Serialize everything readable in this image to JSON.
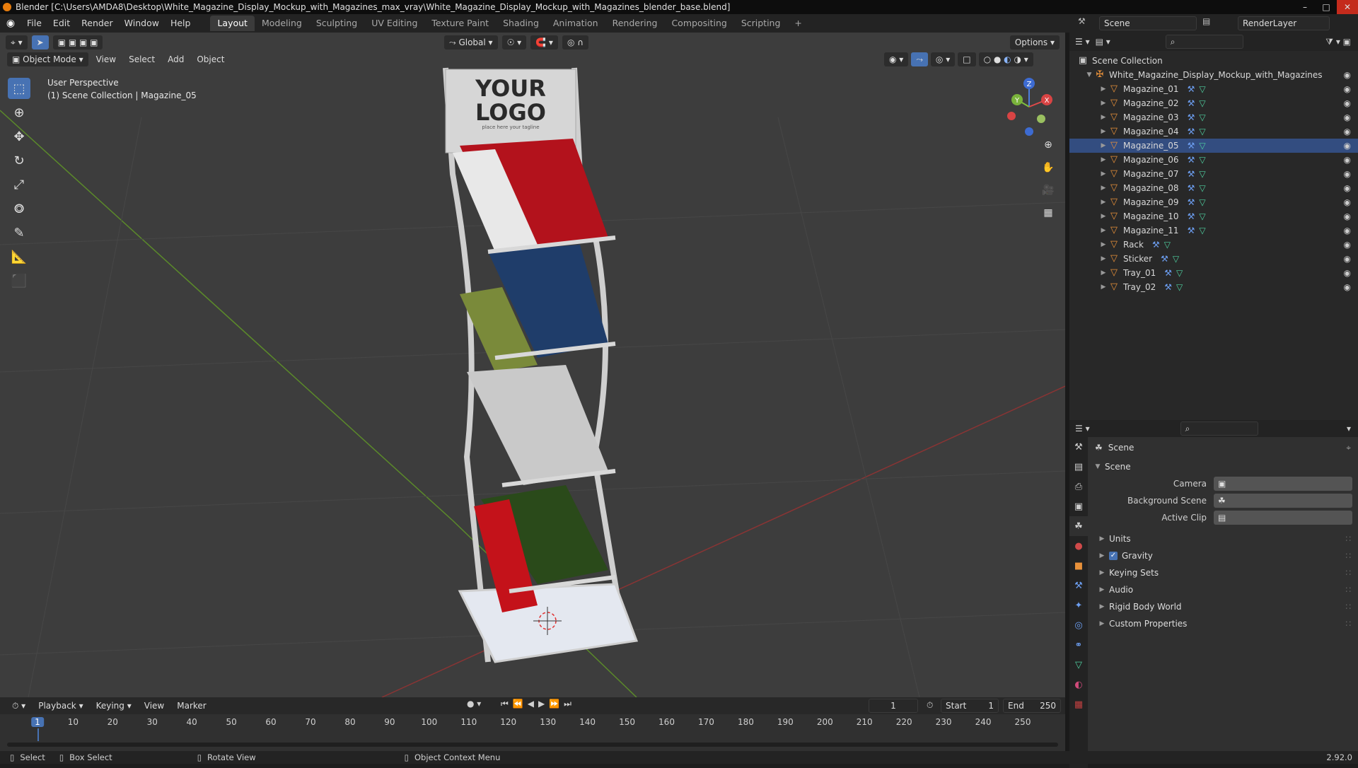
{
  "window": {
    "title": "Blender [C:\\Users\\AMDA8\\Desktop\\White_Magazine_Display_Mockup_with_Magazines_max_vray\\White_Magazine_Display_Mockup_with_Magazines_blender_base.blend]",
    "minimize": "–",
    "maximize": "□",
    "close": "✕"
  },
  "menu": [
    "File",
    "Edit",
    "Render",
    "Window",
    "Help"
  ],
  "workspaces": [
    "Layout",
    "Modeling",
    "Sculpting",
    "UV Editing",
    "Texture Paint",
    "Shading",
    "Animation",
    "Rendering",
    "Compositing",
    "Scripting"
  ],
  "active_workspace": "Layout",
  "add_workspace": "+",
  "scene_name": "Scene",
  "render_layer": "RenderLayer",
  "viewport": {
    "mode": "Object Mode",
    "menus": [
      "View",
      "Select",
      "Add",
      "Object"
    ],
    "transform_orientation": "Global",
    "options": "Options",
    "perspective": "User Perspective",
    "collection_info": "(1) Scene Collection | Magazine_05",
    "sign_logo_line1": "YOUR",
    "sign_logo_line2": "LOGO",
    "sign_tagline": "place here your tagline",
    "gizmo_x": "X",
    "gizmo_y": "Y",
    "gizmo_z": "Z"
  },
  "outliner": {
    "root": "Scene Collection",
    "collection": "White_Magazine_Display_Mockup_with_Magazines",
    "items": [
      "Magazine_01",
      "Magazine_02",
      "Magazine_03",
      "Magazine_04",
      "Magazine_05",
      "Magazine_06",
      "Magazine_07",
      "Magazine_08",
      "Magazine_09",
      "Magazine_10",
      "Magazine_11",
      "Rack",
      "Sticker",
      "Tray_01",
      "Tray_02"
    ],
    "selected": "Magazine_05"
  },
  "properties": {
    "header": "Scene",
    "panel": "Scene",
    "fields": [
      {
        "label": "Camera"
      },
      {
        "label": "Background Scene"
      },
      {
        "label": "Active Clip"
      }
    ],
    "sections": [
      "Units",
      "Gravity",
      "Keying Sets",
      "Audio",
      "Rigid Body World",
      "Custom Properties"
    ],
    "gravity_checked": true
  },
  "timeline": {
    "menus": [
      "Playback",
      "Keying",
      "View",
      "Marker"
    ],
    "current_frame": "1",
    "start_label": "Start",
    "start": "1",
    "end_label": "End",
    "end": "250",
    "ticks": [
      "1",
      "10",
      "20",
      "30",
      "40",
      "50",
      "60",
      "70",
      "80",
      "90",
      "100",
      "110",
      "120",
      "130",
      "140",
      "150",
      "160",
      "170",
      "180",
      "190",
      "200",
      "210",
      "220",
      "230",
      "240",
      "250"
    ]
  },
  "statusbar": {
    "items": [
      "Select",
      "Box Select",
      "Rotate View",
      "Object Context Menu"
    ],
    "version": "2.92.0"
  },
  "colors": {
    "accent": "#4772b3",
    "object_orange": "#e8913a",
    "viewport_bg": "#3d3d3d"
  }
}
